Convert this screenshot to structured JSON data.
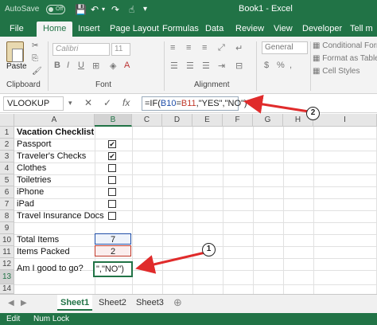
{
  "titlebar": {
    "autosave": "AutoSave",
    "toggle": "Off",
    "title": "Book1 - Excel"
  },
  "tabs": [
    "File",
    "Home",
    "Insert",
    "Page Layout",
    "Formulas",
    "Data",
    "Review",
    "View",
    "Developer",
    "Tell m"
  ],
  "ribbon": {
    "paste": "Paste",
    "clipboard": "Clipboard",
    "font_group": "Font",
    "font_name": "Calibri",
    "font_size": "11",
    "alignment_group": "Alignment",
    "number_format": "General",
    "styles": [
      "Conditional Forma",
      "Format as Table",
      "Cell Styles"
    ],
    "bold": "B",
    "italic": "I",
    "underline": "U"
  },
  "formula_bar": {
    "name_box": "VLOOKUP",
    "cancel": "✕",
    "enter": "✓",
    "fx": "fx",
    "f_prefix": "=IF(",
    "f_ref1": "B10",
    "f_eq": "=",
    "f_ref2": "B11",
    "f_suffix": ",\"YES\",\"NO\")"
  },
  "columns": [
    "A",
    "B",
    "C",
    "D",
    "E",
    "F",
    "G",
    "H",
    "I"
  ],
  "rows": [
    "1",
    "2",
    "3",
    "4",
    "5",
    "6",
    "7",
    "8",
    "9",
    "10",
    "11",
    "12",
    "13",
    "14"
  ],
  "cells": {
    "a1": "Vacation Checklist",
    "a2": "Passport",
    "a3": "Traveler's Checks",
    "a4": "Clothes",
    "a5": "Toiletries",
    "a6": "iPhone",
    "a7": "iPad",
    "a8": "Travel Insurance Docs",
    "a10": "Total Items",
    "a11": "Items Packed",
    "a13": "Am I good to go?",
    "b10": "7",
    "b11": "2",
    "b13": "\",\"NO\")"
  },
  "checkboxes": [
    true,
    true,
    false,
    false,
    false,
    false,
    false
  ],
  "sheets": [
    "Sheet1",
    "Sheet2",
    "Sheet3"
  ],
  "status": {
    "mode": "Edit",
    "numlock": "Num Lock"
  },
  "callouts": [
    "1",
    "2"
  ],
  "colors": {
    "brand": "#217346",
    "arrow": "#e02b2b"
  }
}
